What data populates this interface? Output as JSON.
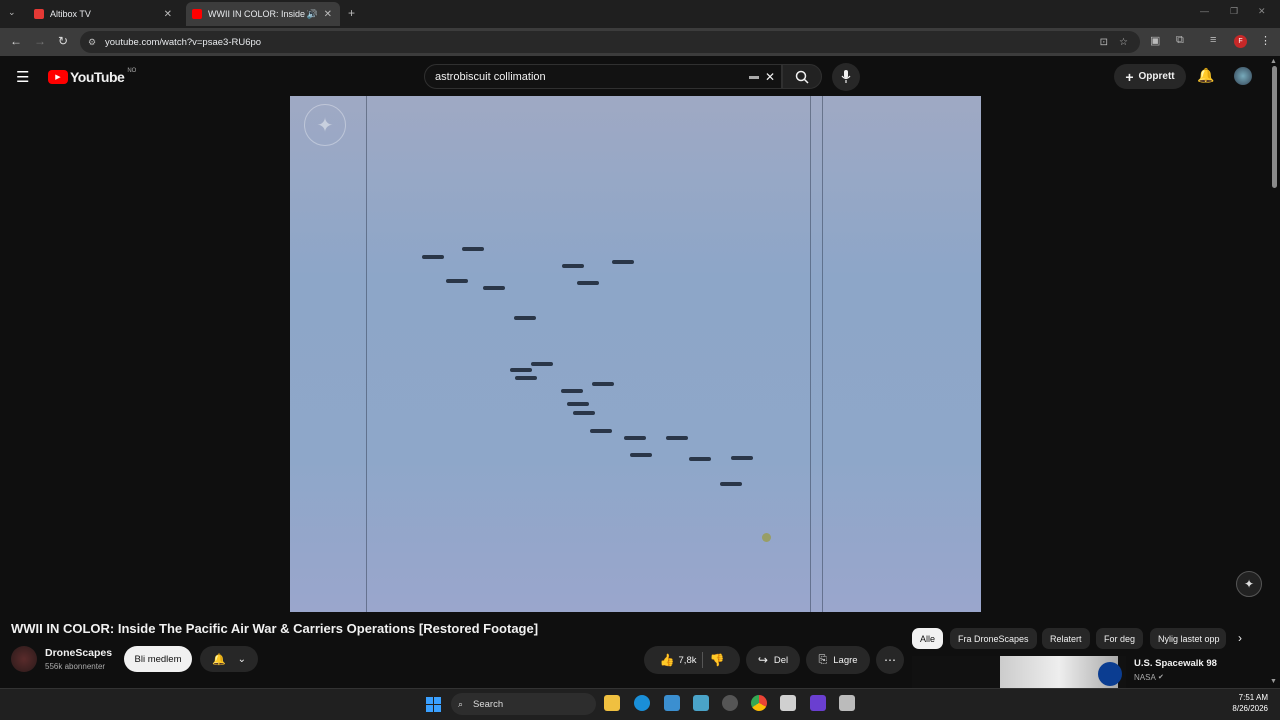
{
  "browser": {
    "tabs": [
      {
        "label": "Altibox TV"
      },
      {
        "label": "WWII IN COLOR: Inside The"
      }
    ],
    "url": "youtube.com/watch?v=psae3-RU6po"
  },
  "youtube": {
    "logo_text": "YouTube",
    "region": "NO",
    "search_query": "astrobiscuit collimation",
    "create_label": "Opprett"
  },
  "video": {
    "title": "WWII IN COLOR: Inside The Pacific Air War & Carriers Operations [Restored Footage]",
    "channel": "DroneScapes",
    "subscribers": "556k abonnenter",
    "join_label": "Bli medlem",
    "likes": "7,8k",
    "share_label": "Del",
    "save_label": "Lagre"
  },
  "chips": [
    "Alle",
    "Fra DroneScapes",
    "Relatert",
    "For deg",
    "Nylig lastet opp"
  ],
  "recommendation": {
    "title": "U.S. Spacewalk 98",
    "channel": "NASA"
  },
  "taskbar": {
    "search_label": "Search",
    "time": "7:51 AM",
    "date": "8/26/2026"
  },
  "colors": {
    "yt_red": "#ff0000",
    "background": "#0f0f0f",
    "accent_tab": "#e53935"
  }
}
